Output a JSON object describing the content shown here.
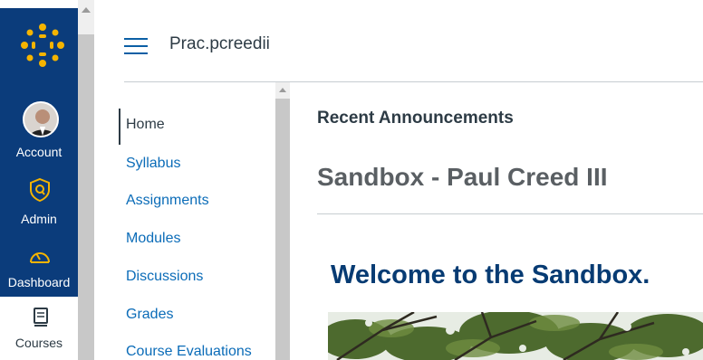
{
  "global_nav": {
    "items": [
      {
        "label": "Account",
        "icon": "avatar"
      },
      {
        "label": "Admin",
        "icon": "shield-icon"
      },
      {
        "label": "Dashboard",
        "icon": "speedometer-icon"
      },
      {
        "label": "Courses",
        "icon": "book-icon"
      }
    ]
  },
  "header": {
    "breadcrumb": "Prac.pcreedii"
  },
  "course_nav": {
    "items": [
      {
        "label": "Home",
        "active": true
      },
      {
        "label": "Syllabus"
      },
      {
        "label": "Assignments"
      },
      {
        "label": "Modules"
      },
      {
        "label": "Discussions"
      },
      {
        "label": "Grades"
      },
      {
        "label": "Course Evaluations"
      }
    ]
  },
  "main": {
    "recent_announcements": "Recent Announcements",
    "page_title": "Sandbox - Paul Creed III",
    "welcome_heading": "Welcome to the Sandbox."
  },
  "colors": {
    "nav_bg": "#0b3c7b",
    "logo_accent": "#f5b400",
    "link": "#0b6cb8",
    "heading_blue": "#073b73"
  }
}
